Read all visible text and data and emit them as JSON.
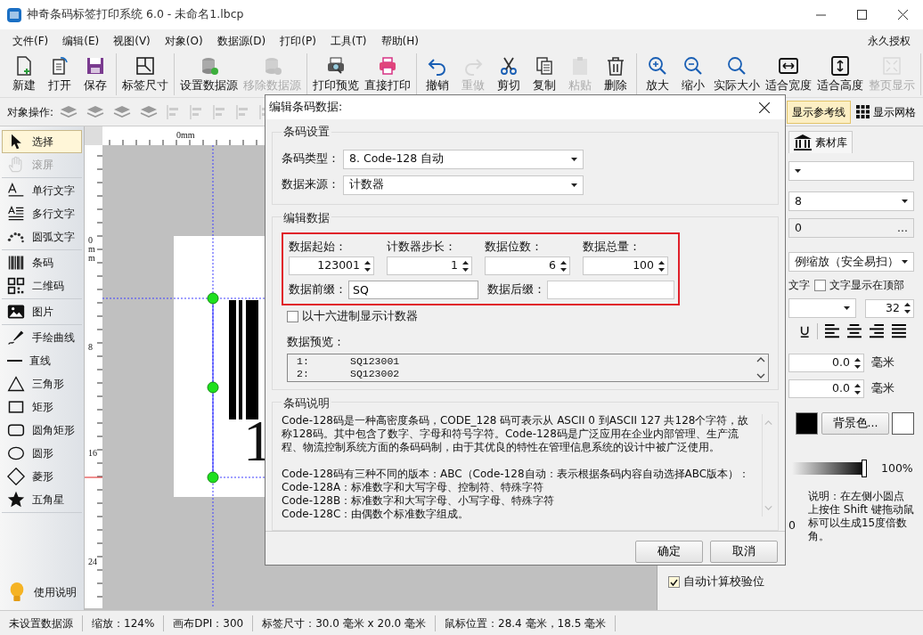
{
  "window": {
    "title": "神奇条码标签打印系统 6.0 - 未命名1.lbcp"
  },
  "menu": [
    "文件(F)",
    "编辑(E)",
    "视图(V)",
    "对象(O)",
    "数据源(D)",
    "打印(P)",
    "工具(T)",
    "帮助(H)"
  ],
  "license": "永久授权",
  "toolbar": [
    [
      {
        "label": "新建",
        "kind": "new",
        "disabled": false
      },
      {
        "label": "打开",
        "kind": "open",
        "disabled": false
      },
      {
        "label": "保存",
        "kind": "save",
        "disabled": false
      }
    ],
    [
      {
        "label": "标签尺寸",
        "kind": "size",
        "disabled": false
      }
    ],
    [
      {
        "label": "设置数据源",
        "kind": "db",
        "disabled": false
      },
      {
        "label": "移除数据源",
        "kind": "db",
        "disabled": true
      }
    ],
    [
      {
        "label": "打印预览",
        "kind": "preview",
        "disabled": false
      },
      {
        "label": "直接打印",
        "kind": "print",
        "disabled": false
      }
    ],
    [
      {
        "label": "撤销",
        "kind": "undo",
        "disabled": false
      },
      {
        "label": "重做",
        "kind": "redo",
        "disabled": true
      },
      {
        "label": "剪切",
        "kind": "cut",
        "disabled": false
      },
      {
        "label": "复制",
        "kind": "copy",
        "disabled": false
      },
      {
        "label": "粘贴",
        "kind": "paste",
        "disabled": true
      },
      {
        "label": "删除",
        "kind": "trash",
        "disabled": false
      }
    ],
    [
      {
        "label": "放大",
        "kind": "zoomin",
        "disabled": false
      },
      {
        "label": "缩小",
        "kind": "zoomout",
        "disabled": false
      },
      {
        "label": "实际大小",
        "kind": "zoom",
        "disabled": false
      },
      {
        "label": "适合宽度",
        "kind": "fitw",
        "disabled": false
      },
      {
        "label": "适合高度",
        "kind": "fith",
        "disabled": false
      },
      {
        "label": "整页显示",
        "kind": "fitp",
        "disabled": true
      }
    ]
  ],
  "object_bar": {
    "label": "对象操作:",
    "toggles": [
      {
        "label": "显示参考线",
        "selected": true
      },
      {
        "label": "显示网格",
        "selected": false
      }
    ]
  },
  "tool_groups": [
    [
      {
        "label": "选择",
        "kind": "pointer",
        "selected": true,
        "disabled": false
      },
      {
        "label": "滚屏",
        "kind": "hand",
        "selected": false,
        "disabled": true
      }
    ],
    [
      {
        "label": "单行文字",
        "kind": "text",
        "selected": false,
        "disabled": false
      },
      {
        "label": "多行文字",
        "kind": "mtext",
        "selected": false,
        "disabled": false
      },
      {
        "label": "圆弧文字",
        "kind": "arc",
        "selected": false,
        "disabled": false
      }
    ],
    [
      {
        "label": "条码",
        "kind": "barcode",
        "selected": false,
        "disabled": false
      },
      {
        "label": "二维码",
        "kind": "qr",
        "selected": false,
        "disabled": false
      }
    ],
    [
      {
        "label": "图片",
        "kind": "image",
        "selected": false,
        "disabled": false
      }
    ],
    [
      {
        "label": "手绘曲线",
        "kind": "pen",
        "selected": false,
        "disabled": false
      },
      {
        "label": "直线",
        "kind": "line",
        "selected": false,
        "disabled": false
      },
      {
        "label": "三角形",
        "kind": "tri",
        "selected": false,
        "disabled": false
      },
      {
        "label": "矩形",
        "kind": "rect",
        "selected": false,
        "disabled": false
      },
      {
        "label": "圆角矩形",
        "kind": "rrect",
        "selected": false,
        "disabled": false
      },
      {
        "label": "圆形",
        "kind": "ellipse",
        "selected": false,
        "disabled": false
      },
      {
        "label": "菱形",
        "kind": "diamond",
        "selected": false,
        "disabled": false
      },
      {
        "label": "五角星",
        "kind": "star",
        "selected": false,
        "disabled": false
      }
    ]
  ],
  "help": "使用说明",
  "canvas": {
    "top_ruler": "0mm",
    "left_ruler": [
      "0mm",
      "8",
      "16",
      "24"
    ],
    "barcode_digit": "1"
  },
  "right_panel": {
    "tab": "素材库",
    "size_select": "8",
    "data_field": "0",
    "browse_button": "...",
    "scale_select": "例缩放（安全易扫）",
    "text_option": "文字",
    "top_text": {
      "label": "文字显示在顶部",
      "checked": false
    },
    "font_size": "32",
    "offsets": [
      {
        "value": "0.0",
        "unit": "毫米"
      },
      {
        "value": "0.0",
        "unit": "毫米"
      }
    ],
    "bg_button": "背景色...",
    "opacity": {
      "level": 1,
      "reading": "100%"
    },
    "angle_fragment": "0",
    "note": "说明：在左侧小圆点上按住 Shift 键拖动鼠标可以生成15度倍数角。",
    "checksum": {
      "label": "自动计算校验位",
      "checked": true
    }
  },
  "dialog": {
    "title": "编辑条码数据:",
    "settings": {
      "title": "条码设置",
      "fields": [
        {
          "label": "条码类型：",
          "value": "8. Code-128 自动"
        },
        {
          "label": "数据来源：",
          "value": "计数器"
        }
      ]
    },
    "edit": {
      "title": "编辑数据",
      "spins": [
        {
          "label": "数据起始：",
          "value": "123001"
        },
        {
          "label": "计数器步长：",
          "value": "1"
        },
        {
          "label": "数据位数：",
          "value": "6"
        },
        {
          "label": "数据总量：",
          "value": "100"
        }
      ],
      "prefix": {
        "label": "数据前缀：",
        "value": "SQ"
      },
      "suffix": {
        "label": "数据后缀："
      },
      "hex": {
        "label": "以十六进制显示计数器",
        "checked": false
      },
      "preview_label": "数据预览：",
      "preview": [
        {
          "index": "1:",
          "value": "SQ123001"
        },
        {
          "index": "2:",
          "value": "SQ123002"
        }
      ]
    },
    "description": {
      "title": "条码说明",
      "lines": [
        "Code-128码是一种高密度条码，CODE_128 码可表示从 ASCII 0 到ASCII 127 共128个字符，故称128码。其中包含了数字、字母和符号字符。Code-128码是广泛应用在企业内部管理、生产流程、物流控制系统方面的条码码制，由于其优良的特性在管理信息系统的设计中被广泛使用。",
        "Code-128码有三种不同的版本：ABC（Code-128自动：表示根据条码内容自动选择ABC版本）：",
        "Code-128A：标准数字和大写字母、控制符、特殊字符",
        "Code-128B：标准数字和大写字母、小写字母、特殊字符",
        "Code-128C：由偶数个标准数字组成。"
      ]
    },
    "buttons": [
      "确定",
      "取消"
    ]
  },
  "status_bar": [
    "未设置数据源",
    "缩放：124%",
    "画布DPI：300",
    "标签尺寸：30.0 毫米 x 20.0 毫米",
    "鼠标位置：28.4 毫米，18.5 毫米"
  ]
}
